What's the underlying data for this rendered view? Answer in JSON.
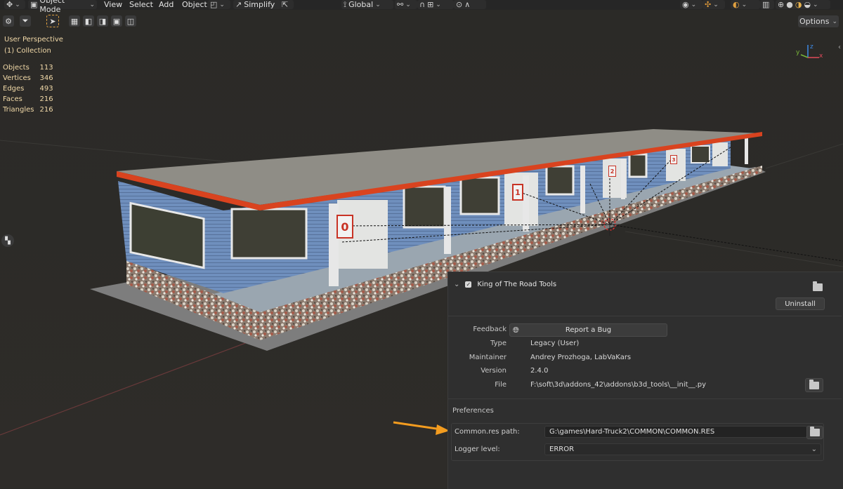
{
  "header": {
    "mode": "Object Mode",
    "menus": [
      "View",
      "Select",
      "Add",
      "Object"
    ],
    "simplify": "Simplify",
    "orientation": "Global"
  },
  "options_label": "Options",
  "overlay": {
    "view_name": "User Perspective",
    "collection": "(1) Collection",
    "stats": [
      {
        "label": "Objects",
        "value": "113"
      },
      {
        "label": "Vertices",
        "value": "346"
      },
      {
        "label": "Edges",
        "value": "493"
      },
      {
        "label": "Faces",
        "value": "216"
      },
      {
        "label": "Triangles",
        "value": "216"
      }
    ]
  },
  "gizmo": {
    "axes": [
      "y",
      "x",
      "z"
    ]
  },
  "building_signs": [
    "0",
    "1",
    "2",
    "3"
  ],
  "addon": {
    "name": "King of The Road Tools",
    "enabled": true,
    "uninstall_label": "Uninstall",
    "feedback_label": "Feedback",
    "report_bug_label": "Report a Bug",
    "type_label": "Type",
    "type_value": "Legacy (User)",
    "maintainer_label": "Maintainer",
    "maintainer_value": "Andrey Prozhoga, LabVaKars",
    "version_label": "Version",
    "version_value": "2.4.0",
    "file_label": "File",
    "file_value": "F:\\soft\\3d\\addons_42\\addons\\b3d_tools\\__init__.py",
    "preferences_title": "Preferences",
    "common_res_label": "Common.res path:",
    "common_res_value": "G:\\games\\Hard-Truck2\\COMMON\\COMMON.RES",
    "logger_label": "Logger level:",
    "logger_value": "ERROR"
  },
  "colors": {
    "annotation_arrow": "#f39c1f",
    "overlay_text": "#f2d9a8",
    "roof_trim": "#d9431f"
  }
}
